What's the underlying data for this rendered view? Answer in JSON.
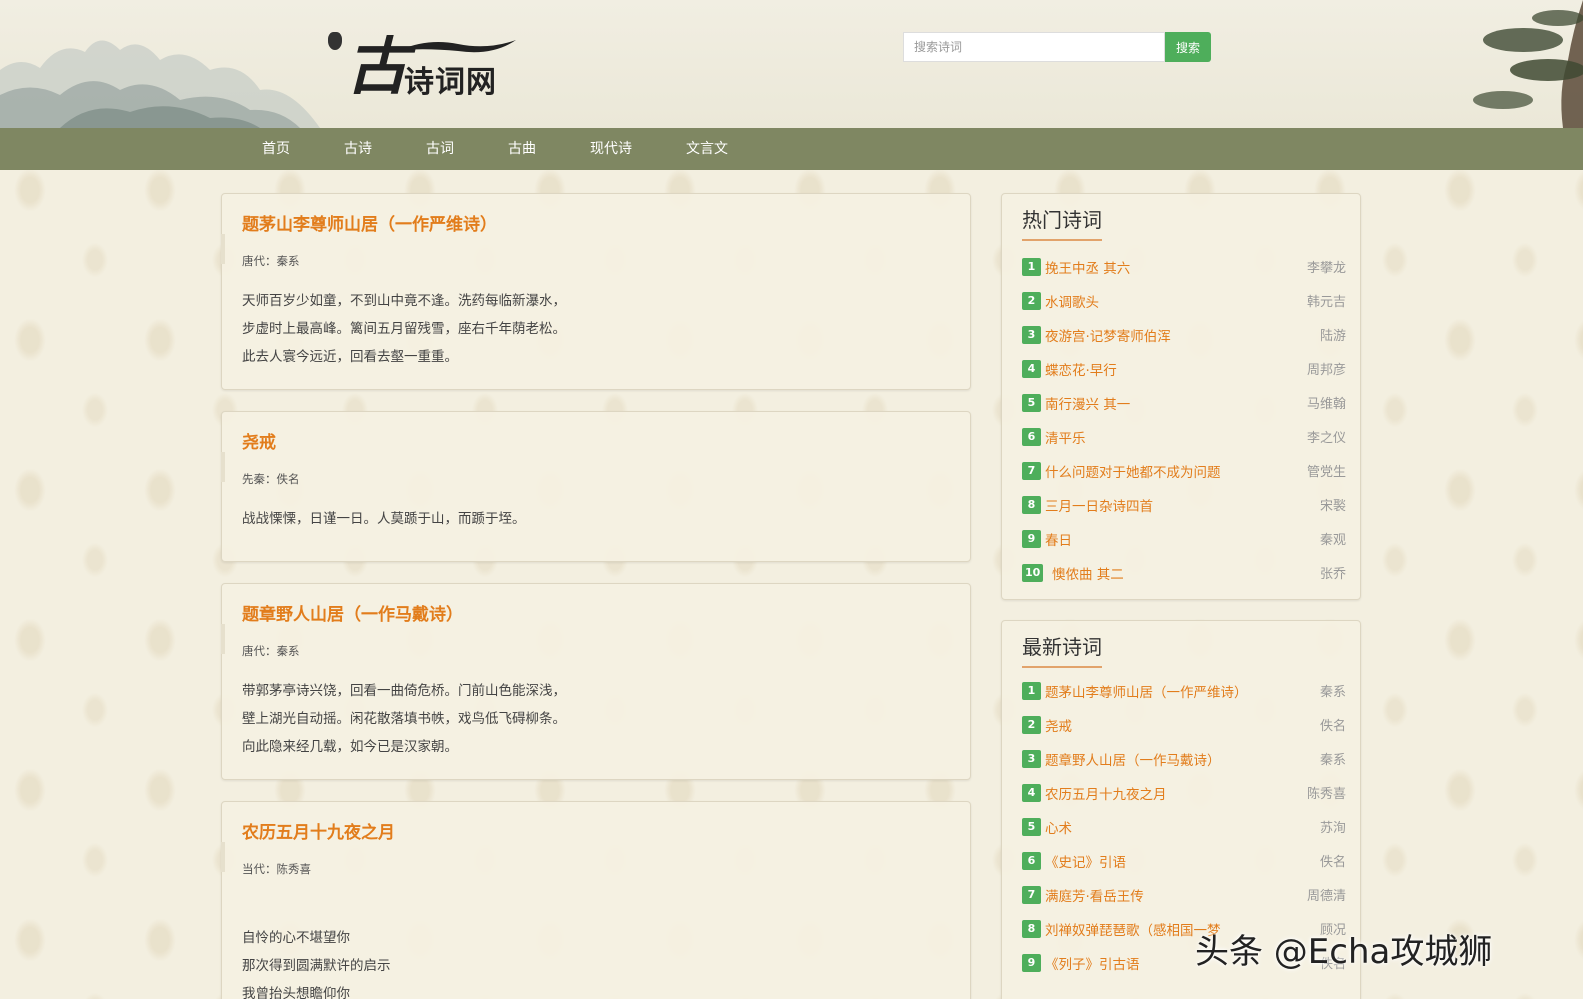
{
  "site": {
    "logo_big": "古",
    "logo_small": "诗词网"
  },
  "search": {
    "placeholder": "搜索诗词",
    "button": "搜索"
  },
  "nav": [
    "首页",
    "古诗",
    "古词",
    "古曲",
    "现代诗",
    "文言文"
  ],
  "poems": [
    {
      "title": "题茅山李尊师山居（一作严维诗）",
      "meta": "唐代：秦系",
      "lines": [
        "天师百岁少如童，不到山中竟不逢。洗药每临新瀑水，",
        "步虚时上最高峰。篱间五月留残雪，座右千年荫老松。",
        "此去人寰今远近，回看去壑一重重。"
      ]
    },
    {
      "title": "尧戒",
      "meta": "先秦：佚名",
      "lines": [
        "战战慄慄，日谨一日。人莫踬于山，而踬于垤。"
      ]
    },
    {
      "title": "题章野人山居（一作马戴诗）",
      "meta": "唐代：秦系",
      "lines": [
        "带郭茅亭诗兴饶，回看一曲倚危桥。门前山色能深浅，",
        "壁上湖光自动摇。闲花散落填书帙，戏鸟低飞碍柳条。",
        "向此隐来经几载，如今已是汉家朝。"
      ]
    },
    {
      "title": "农历五月十九夜之月",
      "meta": "当代：陈秀喜",
      "lines": [
        "自怜的心不堪望你",
        "那次得到圆满默许的启示",
        "我曾抬头想瞻仰你"
      ]
    }
  ],
  "hot": {
    "title": "热门诗词",
    "items": [
      {
        "n": "1",
        "t": "挽王中丞 其六",
        "a": "李攀龙"
      },
      {
        "n": "2",
        "t": "水调歌头",
        "a": "韩元吉"
      },
      {
        "n": "3",
        "t": "夜游宫·记梦寄师伯浑",
        "a": "陆游"
      },
      {
        "n": "4",
        "t": "蝶恋花·早行",
        "a": "周邦彦"
      },
      {
        "n": "5",
        "t": "南行漫兴 其一",
        "a": "马维翰"
      },
      {
        "n": "6",
        "t": "清平乐",
        "a": "李之仪"
      },
      {
        "n": "7",
        "t": "什么问题对于她都不成为问题",
        "a": "管党生"
      },
      {
        "n": "8",
        "t": "三月一日杂诗四首",
        "a": "宋褧"
      },
      {
        "n": "9",
        "t": "春日",
        "a": "秦观"
      },
      {
        "n": "10",
        "t": "懊侬曲 其二",
        "a": "张乔"
      }
    ]
  },
  "latest": {
    "title": "最新诗词",
    "items": [
      {
        "n": "1",
        "t": "题茅山李尊师山居（一作严维诗）",
        "a": "秦系"
      },
      {
        "n": "2",
        "t": "尧戒",
        "a": "佚名"
      },
      {
        "n": "3",
        "t": "题章野人山居（一作马戴诗）",
        "a": "秦系"
      },
      {
        "n": "4",
        "t": "农历五月十九夜之月",
        "a": "陈秀喜"
      },
      {
        "n": "5",
        "t": "心术",
        "a": "苏洵"
      },
      {
        "n": "6",
        "t": "《史记》引语",
        "a": "佚名"
      },
      {
        "n": "7",
        "t": "满庭芳·看岳王传",
        "a": "周德清"
      },
      {
        "n": "8",
        "t": "刘禅奴弹琵琶歌（感相国一梦",
        "a": "顾况"
      },
      {
        "n": "9",
        "t": "《列子》引古语",
        "a": "佚名"
      }
    ]
  },
  "watermark": "头条 @Echa攻城狮",
  "colors": {
    "accent": "#e27d1c",
    "nav": "#7f8762",
    "badge": "#4eae5b"
  }
}
